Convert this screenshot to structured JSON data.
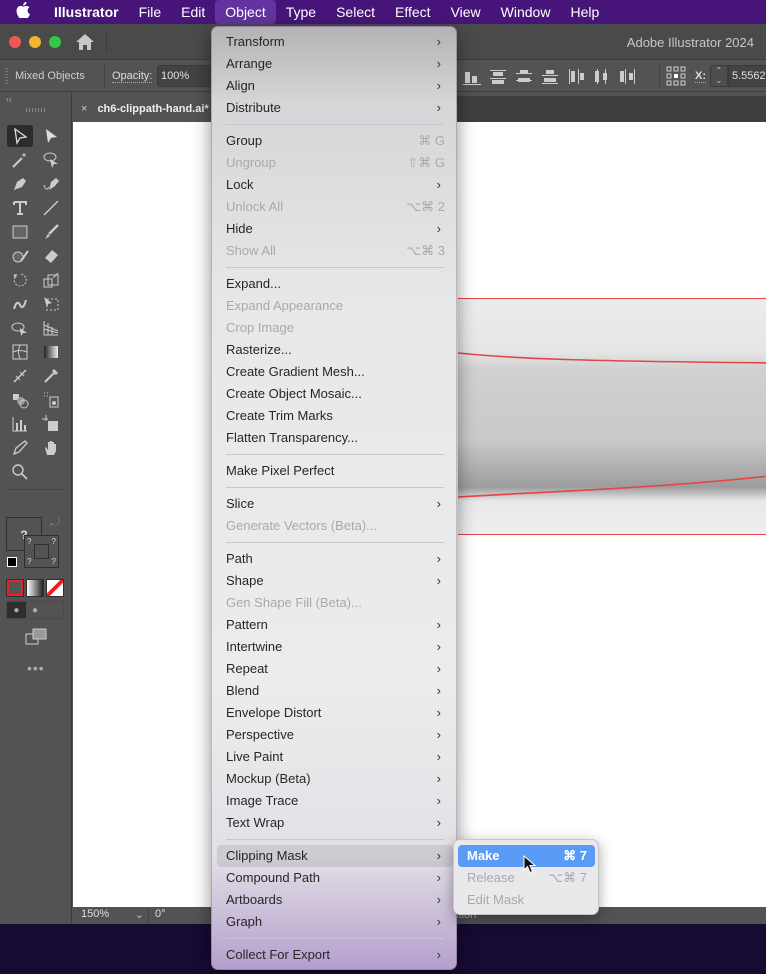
{
  "menubar": {
    "apple": "",
    "items": [
      "Illustrator",
      "File",
      "Edit",
      "Object",
      "Type",
      "Select",
      "Effect",
      "View",
      "Window",
      "Help"
    ],
    "active": "Object"
  },
  "titlebar": {
    "app_title": "Adobe Illustrator 2024"
  },
  "controlbar": {
    "selection_label": "Mixed Objects",
    "opacity_label": "Opacity:",
    "opacity_value": "100%",
    "x_label": "X:",
    "x_value": "5.5562"
  },
  "document": {
    "tab_title": "ch6-clippath-hand.ai*",
    "tab_close": "×",
    "zoom": "150%",
    "rotation": "0°",
    "status_text": "ction"
  },
  "toolbar": {
    "collapse": "‹‹",
    "fill_unknown": "?",
    "more": "•••"
  },
  "object_menu": {
    "items": [
      {
        "label": "Transform",
        "submenu": true
      },
      {
        "label": "Arrange",
        "submenu": true
      },
      {
        "label": "Align",
        "submenu": true
      },
      {
        "label": "Distribute",
        "submenu": true
      },
      {
        "sep": true
      },
      {
        "label": "Group",
        "shortcut": "⌘ G"
      },
      {
        "label": "Ungroup",
        "shortcut": "⇧⌘ G",
        "disabled": true
      },
      {
        "label": "Lock",
        "submenu": true
      },
      {
        "label": "Unlock All",
        "shortcut": "⌥⌘ 2",
        "disabled": true
      },
      {
        "label": "Hide",
        "submenu": true
      },
      {
        "label": "Show All",
        "shortcut": "⌥⌘ 3",
        "disabled": true
      },
      {
        "sep": true
      },
      {
        "label": "Expand..."
      },
      {
        "label": "Expand Appearance",
        "disabled": true
      },
      {
        "label": "Crop Image",
        "disabled": true
      },
      {
        "label": "Rasterize..."
      },
      {
        "label": "Create Gradient Mesh..."
      },
      {
        "label": "Create Object Mosaic..."
      },
      {
        "label": "Create Trim Marks"
      },
      {
        "label": "Flatten Transparency..."
      },
      {
        "sep": true
      },
      {
        "label": "Make Pixel Perfect"
      },
      {
        "sep": true
      },
      {
        "label": "Slice",
        "submenu": true
      },
      {
        "label": "Generate Vectors (Beta)...",
        "disabled": true
      },
      {
        "sep": true
      },
      {
        "label": "Path",
        "submenu": true
      },
      {
        "label": "Shape",
        "submenu": true
      },
      {
        "label": "Gen Shape Fill (Beta)...",
        "disabled": true
      },
      {
        "label": "Pattern",
        "submenu": true
      },
      {
        "label": "Intertwine",
        "submenu": true
      },
      {
        "label": "Repeat",
        "submenu": true
      },
      {
        "label": "Blend",
        "submenu": true
      },
      {
        "label": "Envelope Distort",
        "submenu": true
      },
      {
        "label": "Perspective",
        "submenu": true
      },
      {
        "label": "Live Paint",
        "submenu": true
      },
      {
        "label": "Mockup (Beta)",
        "submenu": true
      },
      {
        "label": "Image Trace",
        "submenu": true
      },
      {
        "label": "Text Wrap",
        "submenu": true
      },
      {
        "sep": true
      },
      {
        "label": "Clipping Mask",
        "submenu": true,
        "hover": true
      },
      {
        "label": "Compound Path",
        "submenu": true
      },
      {
        "label": "Artboards",
        "submenu": true
      },
      {
        "label": "Graph",
        "submenu": true
      },
      {
        "sep": true
      },
      {
        "label": "Collect For Export",
        "submenu": true
      }
    ],
    "arrow": "›"
  },
  "clipping_submenu": {
    "items": [
      {
        "label": "Make",
        "shortcut": "⌘ 7",
        "active": true
      },
      {
        "label": "Release",
        "shortcut": "⌥⌘ 7",
        "disabled": true
      },
      {
        "label": "Edit Mask",
        "shortcut": "",
        "disabled": true
      }
    ]
  },
  "colors": {
    "menubar_bg": "#47157a",
    "highlight": "#5a9bf6",
    "clip_path": "#e64545"
  }
}
